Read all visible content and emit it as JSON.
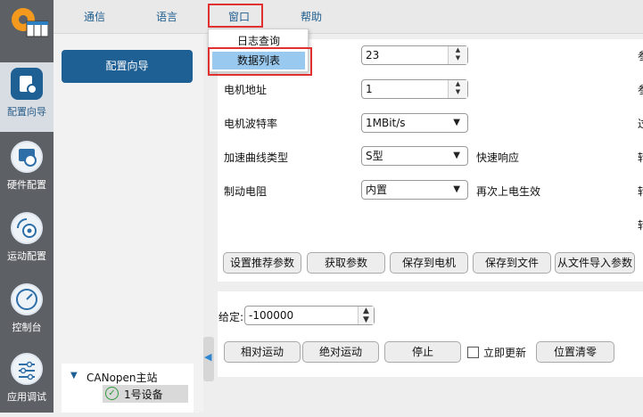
{
  "sidebar": {
    "items": [
      {
        "label": "配置向导",
        "icon": "wizard-icon"
      },
      {
        "label": "硬件配置",
        "icon": "hardware-gear-icon"
      },
      {
        "label": "运动配置",
        "icon": "motion-gear-icon"
      },
      {
        "label": "控制台",
        "icon": "gauge-icon"
      },
      {
        "label": "应用调试",
        "icon": "sliders-icon"
      }
    ]
  },
  "menubar": {
    "items": [
      "通信",
      "语言",
      "窗口",
      "帮助"
    ]
  },
  "window_menu": {
    "items": [
      "日志查询",
      "数据列表"
    ]
  },
  "wizard_button": "配置向导",
  "form": {
    "field1_value": "23",
    "motor_address_label": "电机地址",
    "motor_address_value": "1",
    "baud_label": "电机波特率",
    "baud_value": "1MBit/s",
    "accel_label": "加速曲线类型",
    "accel_value": "S型",
    "accel_note": "快速响应",
    "brake_label": "制动电阻",
    "brake_value": "内置",
    "brake_note": "再次上电生效",
    "right_clip": [
      "参",
      "参",
      "过",
      "转",
      "转",
      "转"
    ]
  },
  "param_buttons": [
    "设置推荐参数",
    "获取参数",
    "保存到电机",
    "保存到文件",
    "从文件导入参数"
  ],
  "motion": {
    "given_label": "给定:",
    "given_value": "-100000",
    "buttons": [
      "相对运动",
      "绝对运动",
      "停止"
    ],
    "immediate_update": "立即更新",
    "position_clear": "位置清零"
  },
  "tree": {
    "root": "CANopen主站",
    "device": "1号设备"
  },
  "colors": {
    "accent": "#1e5f94",
    "menu_text": "#1f5d8e",
    "highlight": "#99c9ef",
    "annotation_red": "#e03030"
  }
}
